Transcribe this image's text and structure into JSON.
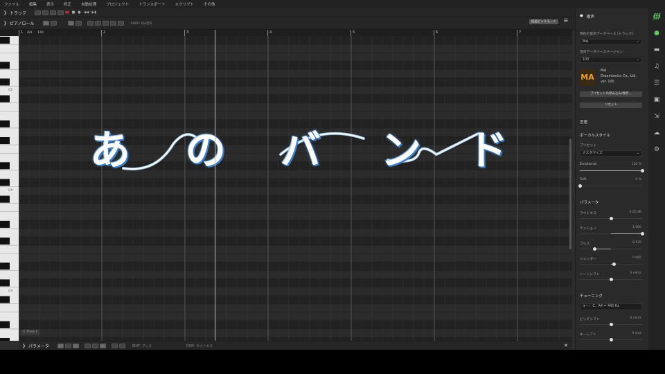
{
  "menu": [
    "ファイル",
    "編集",
    "表示",
    "修正",
    "自動処理",
    "プロジェクト",
    "トランスポート",
    "スクリプト",
    "その他"
  ],
  "track_panel": {
    "title": "トラック"
  },
  "pianoroll": {
    "title": "ピアノロール",
    "snap": "SNAP: 8分音符",
    "pitch_mode": "描画ピッチモード",
    "ruler": {
      "time_signature": "4/4",
      "tempo": "120",
      "bars": [
        "1",
        "2",
        "3",
        "4",
        "5",
        "6",
        "7"
      ]
    },
    "octaves": [
      "C5",
      "C4",
      "C3"
    ],
    "track_label": "Track 1"
  },
  "lyrics_overlay": {
    "chars": [
      "あ",
      "の",
      "バ",
      "ー",
      "ン",
      "ド"
    ]
  },
  "param_panel": {
    "title": "パラメータ",
    "edit": "EDIT: ブレス",
    "disp": "DISP: ラウドネス"
  },
  "right_panel": {
    "header": "歌声",
    "db_label": "現在の音声データベース (トラック)",
    "db_value": "Mai",
    "ver_label": "音声データベースバージョン",
    "ver_value": "100",
    "voice_name": "Mai",
    "voice_vendor": "Dreamtonics Co., Ltd.",
    "voice_ver": "ver. 100",
    "logo_text": "MA",
    "preset_btn": "プリセットの読み込み/保存...",
    "reset_btn": "リセット",
    "language": "言語",
    "vocal_style": "ボーカルスタイル",
    "preset_label": "プリセット",
    "preset_value": "カスタマイズ",
    "emotional": {
      "label": "Emotional",
      "value": "150 %",
      "level": 1.0
    },
    "soft": {
      "label": "Soft",
      "value": "0 %",
      "level": 0.0
    },
    "params_header": "パラメータ",
    "loudness": {
      "label": "ラウドネス",
      "value": "0.00 dB",
      "level": 0.5
    },
    "tension": {
      "label": "テンション",
      "value": "1.000",
      "level": 1.0
    },
    "breath": {
      "label": "ブレス",
      "value": "-0.535",
      "level": 0.23
    },
    "gender": {
      "label": "ジェンダー",
      "value": "0.085",
      "level": 0.54
    },
    "toneshift": {
      "label": "トーンシフト",
      "value": "0 cents",
      "level": 0.5
    },
    "tuning_header": "チューニング",
    "key_value": "キー：C、A4 = 440 Hz",
    "pitchshift": {
      "label": "ピッチシフト",
      "value": "0 cents",
      "level": 0.5
    },
    "keyshift": {
      "label": "キーシフト",
      "value": "0 smL",
      "level": 0.5
    }
  },
  "icons": [
    "app-logo-icon",
    "microphone-icon",
    "clapper-icon",
    "music-note-icon",
    "library-icon",
    "book-icon",
    "export-icon",
    "cloud-icon",
    "gear-icon"
  ],
  "colors": {
    "accent": "#5ec85e",
    "lyric_glow": "#3a7fc8",
    "panel_bg": "#2a2a2a"
  }
}
